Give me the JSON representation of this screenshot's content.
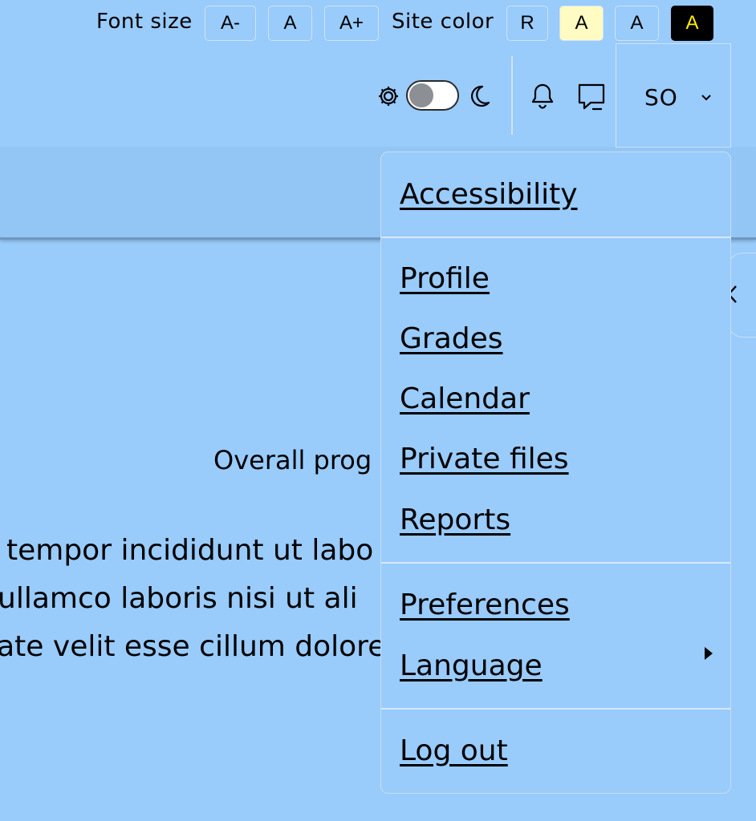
{
  "accessibility_bar": {
    "font_size_label": "Font size",
    "font_decrease": "A-",
    "font_reset": "A",
    "font_increase": "A+",
    "site_color_label": "Site color",
    "color_reset": "R",
    "color_yellow": "A",
    "color_default": "A",
    "color_dark": "A"
  },
  "colors": {
    "background": "#99cbfb",
    "yellow_option_bg": "#fffbc2",
    "dark_option_bg": "#000000",
    "dark_option_fg": "#ffee00"
  },
  "navbar": {
    "theme_toggle_state": "off",
    "user_initials": "SO"
  },
  "main": {
    "progress_label": "Overall prog",
    "body_lines": [
      "tempor incididunt ut labo",
      "ullamco laboris nisi ut ali",
      "tate velit esse cillum dolore"
    ]
  },
  "user_menu": {
    "items": [
      {
        "label": "Accessibility"
      },
      {
        "label": "Profile"
      },
      {
        "label": "Grades"
      },
      {
        "label": "Calendar"
      },
      {
        "label": "Private files"
      },
      {
        "label": "Reports"
      },
      {
        "label": "Preferences"
      },
      {
        "label": "Language"
      },
      {
        "label": "Log out"
      }
    ]
  }
}
